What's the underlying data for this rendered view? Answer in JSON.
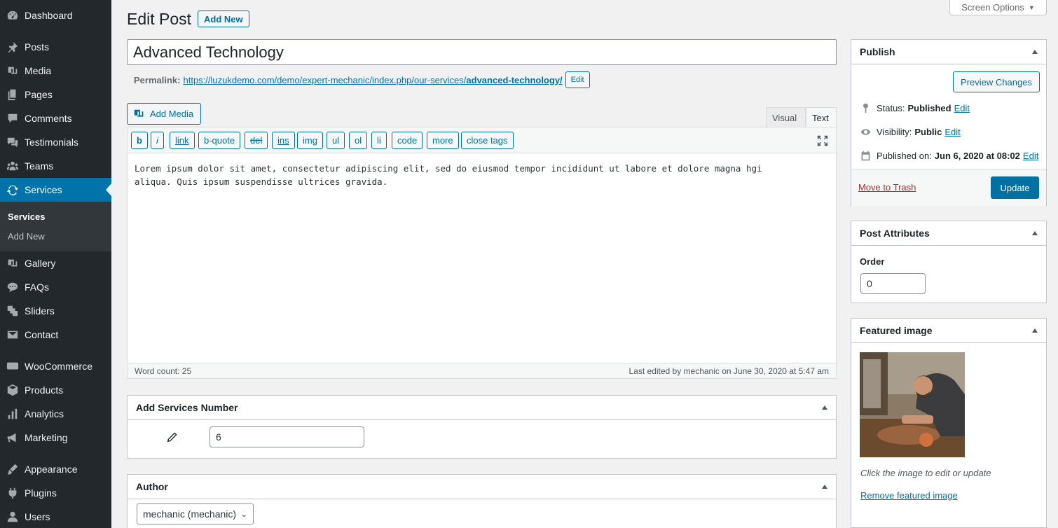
{
  "sidebar": {
    "items": [
      {
        "label": "Dashboard",
        "icon": "dashboard-icon"
      },
      {
        "label": "Posts",
        "icon": "pin-icon"
      },
      {
        "label": "Media",
        "icon": "media-icon"
      },
      {
        "label": "Pages",
        "icon": "pages-icon"
      },
      {
        "label": "Comments",
        "icon": "comments-icon"
      },
      {
        "label": "Testimonials",
        "icon": "testimonials-icon"
      },
      {
        "label": "Teams",
        "icon": "teams-icon"
      },
      {
        "label": "Services",
        "icon": "services-icon",
        "active": true
      },
      {
        "label": "Gallery",
        "icon": "gallery-icon"
      },
      {
        "label": "FAQs",
        "icon": "faqs-icon"
      },
      {
        "label": "Sliders",
        "icon": "sliders-icon"
      },
      {
        "label": "Contact",
        "icon": "contact-icon"
      },
      {
        "label": "WooCommerce",
        "icon": "woocommerce-icon"
      },
      {
        "label": "Products",
        "icon": "products-icon"
      },
      {
        "label": "Analytics",
        "icon": "analytics-icon"
      },
      {
        "label": "Marketing",
        "icon": "marketing-icon"
      },
      {
        "label": "Appearance",
        "icon": "appearance-icon"
      },
      {
        "label": "Plugins",
        "icon": "plugins-icon"
      },
      {
        "label": "Users",
        "icon": "users-icon"
      }
    ],
    "submenu": [
      {
        "label": "Services",
        "current": true
      },
      {
        "label": "Add New"
      }
    ]
  },
  "header": {
    "title": "Edit Post",
    "add_new": "Add New",
    "screen_options": "Screen Options"
  },
  "post": {
    "title": "Advanced Technology",
    "permalink_label": "Permalink:",
    "permalink_base": "https://luzukdemo.com/demo/expert-mechanic/index.php/our-services/",
    "permalink_slug": "advanced-technology/",
    "permalink_edit": "Edit"
  },
  "editor": {
    "add_media": "Add Media",
    "tab_visual": "Visual",
    "tab_text": "Text",
    "quicktags": [
      "b",
      "i",
      "link",
      "b-quote",
      "del",
      "ins",
      "img",
      "ul",
      "ol",
      "li",
      "code",
      "more",
      "close tags"
    ],
    "content_line1": "Lorem ipsum dolor sit amet, consectetur adipiscing elit, sed do eiusmod tempor incididunt ut labore et dolore magna hgi",
    "content_line2": "aliqua. Quis ipsum suspendisse ultrices gravida.",
    "word_count": "Word count: 25",
    "last_edited": "Last edited by mechanic on June 30, 2020 at 5:47 am"
  },
  "services_number": {
    "title": "Add Services Number",
    "value": "6"
  },
  "author": {
    "title": "Author",
    "selected": "mechanic (mechanic)"
  },
  "publish": {
    "title": "Publish",
    "preview": "Preview Changes",
    "status_label": "Status:",
    "status_value": "Published",
    "visibility_label": "Visibility:",
    "visibility_value": "Public",
    "published_label": "Published on:",
    "published_value": "Jun 6, 2020 at 08:02",
    "edit": "Edit",
    "trash": "Move to Trash",
    "update": "Update"
  },
  "attributes": {
    "title": "Post Attributes",
    "order_label": "Order",
    "order_value": "0"
  },
  "featured": {
    "title": "Featured image",
    "hint": "Click the image to edit or update",
    "remove": "Remove featured image"
  },
  "colors": {
    "sidebar_bg": "#23282d",
    "accent": "#0073aa",
    "primary_button": "#0071a1",
    "trash": "#b32d2e"
  }
}
